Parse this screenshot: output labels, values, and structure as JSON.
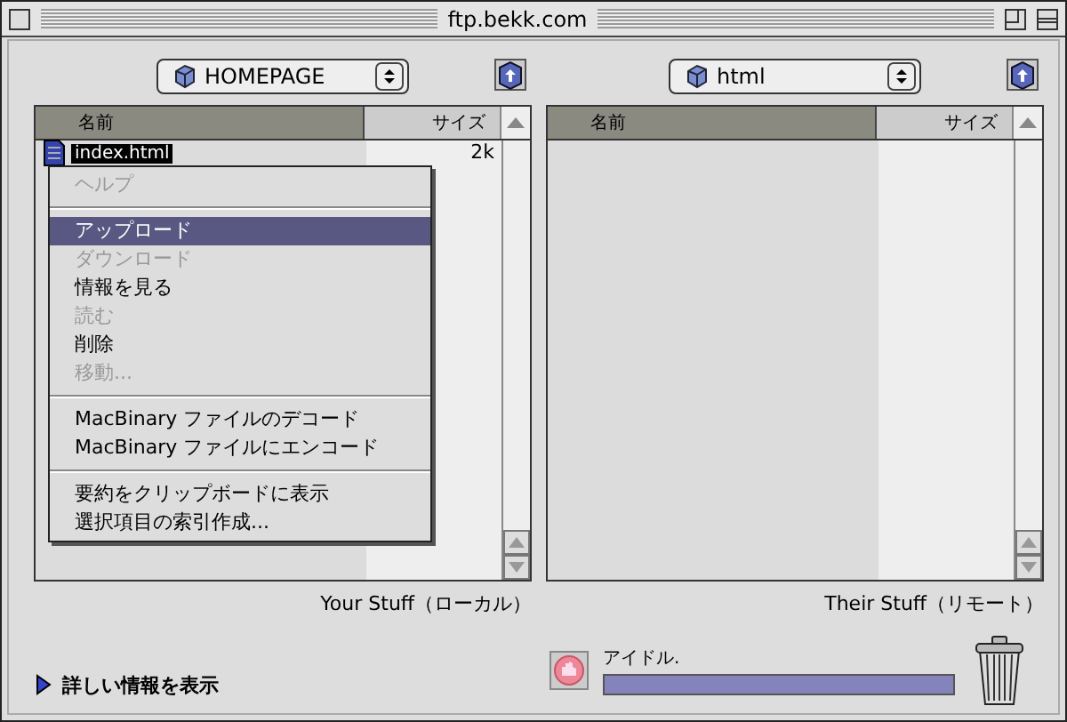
{
  "window": {
    "title": "ftp.bekk.com"
  },
  "panes": [
    {
      "folder": "HOMEPAGE",
      "columns": [
        "名前",
        "サイズ"
      ],
      "rows": [
        {
          "name": "index.html",
          "size": "2k",
          "selected": true
        }
      ],
      "caption": "Your Stuff（ローカル）"
    },
    {
      "folder": "html",
      "columns": [
        "名前",
        "サイズ"
      ],
      "caption": "Their Stuff（リモート）"
    }
  ],
  "context_menu": [
    {
      "kind": "item",
      "label": "ヘルプ",
      "disabled": true,
      "selected": false
    },
    {
      "kind": "separator"
    },
    {
      "kind": "item",
      "label": "アップロード",
      "disabled": false,
      "selected": true
    },
    {
      "kind": "item",
      "label": "ダウンロード",
      "disabled": true,
      "selected": false
    },
    {
      "kind": "item",
      "label": "情報を見る",
      "disabled": false,
      "selected": false
    },
    {
      "kind": "item",
      "label": "読む",
      "disabled": true,
      "selected": false
    },
    {
      "kind": "item",
      "label": "削除",
      "disabled": false,
      "selected": false
    },
    {
      "kind": "item",
      "label": "移動...",
      "disabled": true,
      "selected": false
    },
    {
      "kind": "separator"
    },
    {
      "kind": "item",
      "label": "MacBinary ファイルのデコード",
      "disabled": false,
      "selected": false
    },
    {
      "kind": "item",
      "label": "MacBinary ファイルにエンコード",
      "disabled": false,
      "selected": false
    },
    {
      "kind": "separator"
    },
    {
      "kind": "item",
      "label": "要約をクリップボードに表示",
      "disabled": false,
      "selected": false
    },
    {
      "kind": "item",
      "label": "選択項目の索引作成...",
      "disabled": false,
      "selected": false
    }
  ],
  "details_toggle": {
    "label": "詳しい情報を表示",
    "expanded": false
  },
  "status": {
    "text": "アイドル.",
    "level": 1
  }
}
